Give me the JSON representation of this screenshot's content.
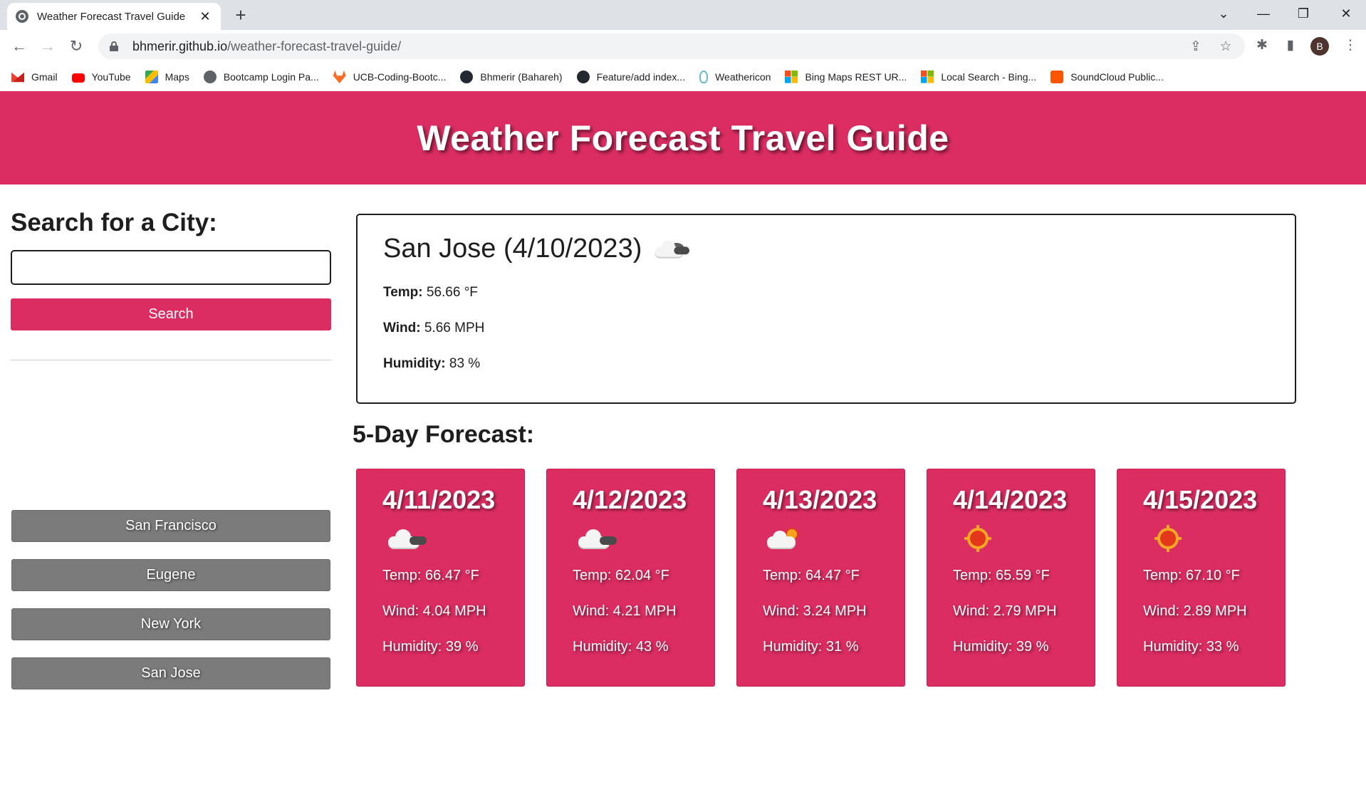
{
  "browser": {
    "tab_title": "Weather Forecast Travel Guide",
    "tab_close": "✕",
    "new_tab": "+",
    "url_host": "bhmerir.github.io",
    "url_path": "/weather-forecast-travel-guide/",
    "profile_initial": "B",
    "bookmarks": [
      {
        "label": "Gmail",
        "icon": "gmail-icon"
      },
      {
        "label": "YouTube",
        "icon": "youtube-icon"
      },
      {
        "label": "Maps",
        "icon": "maps-icon"
      },
      {
        "label": "Bootcamp Login Pa...",
        "icon": "globe-icon"
      },
      {
        "label": "UCB-Coding-Bootc...",
        "icon": "gitlab-icon"
      },
      {
        "label": "Bhmerir (Bahareh)",
        "icon": "github-icon"
      },
      {
        "label": "Feature/add index...",
        "icon": "github-icon"
      },
      {
        "label": "Weathericon",
        "icon": "weathericon-icon"
      },
      {
        "label": "Bing Maps REST UR...",
        "icon": "microsoft-icon"
      },
      {
        "label": "Local Search - Bing...",
        "icon": "microsoft-icon"
      },
      {
        "label": "SoundCloud Public...",
        "icon": "soundcloud-icon"
      }
    ]
  },
  "header": {
    "title": "Weather Forecast Travel Guide",
    "color": "#dc2d62"
  },
  "sidebar": {
    "heading": "Search for a City:",
    "search_value": "",
    "search_button": "Search",
    "history": [
      "San Francisco",
      "Eugene",
      "New York",
      "San Jose"
    ]
  },
  "current": {
    "title": "San Jose (4/10/2023)",
    "icon": "cloudy-icon",
    "temp_label": "Temp:",
    "temp_value": "56.66 °F",
    "wind_label": "Wind:",
    "wind_value": "5.66 MPH",
    "humidity_label": "Humidity:",
    "humidity_value": "83 %"
  },
  "forecast": {
    "heading": "5-Day Forecast:",
    "days": [
      {
        "date": "4/11/2023",
        "icon": "cloudy-icon",
        "temp": "Temp: 66.47 °F",
        "wind": "Wind: 4.04 MPH",
        "humidity": "Humidity: 39 %"
      },
      {
        "date": "4/12/2023",
        "icon": "cloudy-icon",
        "temp": "Temp: 62.04 °F",
        "wind": "Wind: 4.21 MPH",
        "humidity": "Humidity: 43 %"
      },
      {
        "date": "4/13/2023",
        "icon": "partly-sunny-icon",
        "temp": "Temp: 64.47 °F",
        "wind": "Wind: 3.24 MPH",
        "humidity": "Humidity: 31 %"
      },
      {
        "date": "4/14/2023",
        "icon": "sun-icon",
        "temp": "Temp: 65.59 °F",
        "wind": "Wind: 2.79 MPH",
        "humidity": "Humidity: 39 %"
      },
      {
        "date": "4/15/2023",
        "icon": "sun-icon",
        "temp": "Temp: 67.10 °F",
        "wind": "Wind: 2.89 MPH",
        "humidity": "Humidity: 33 %"
      }
    ]
  }
}
